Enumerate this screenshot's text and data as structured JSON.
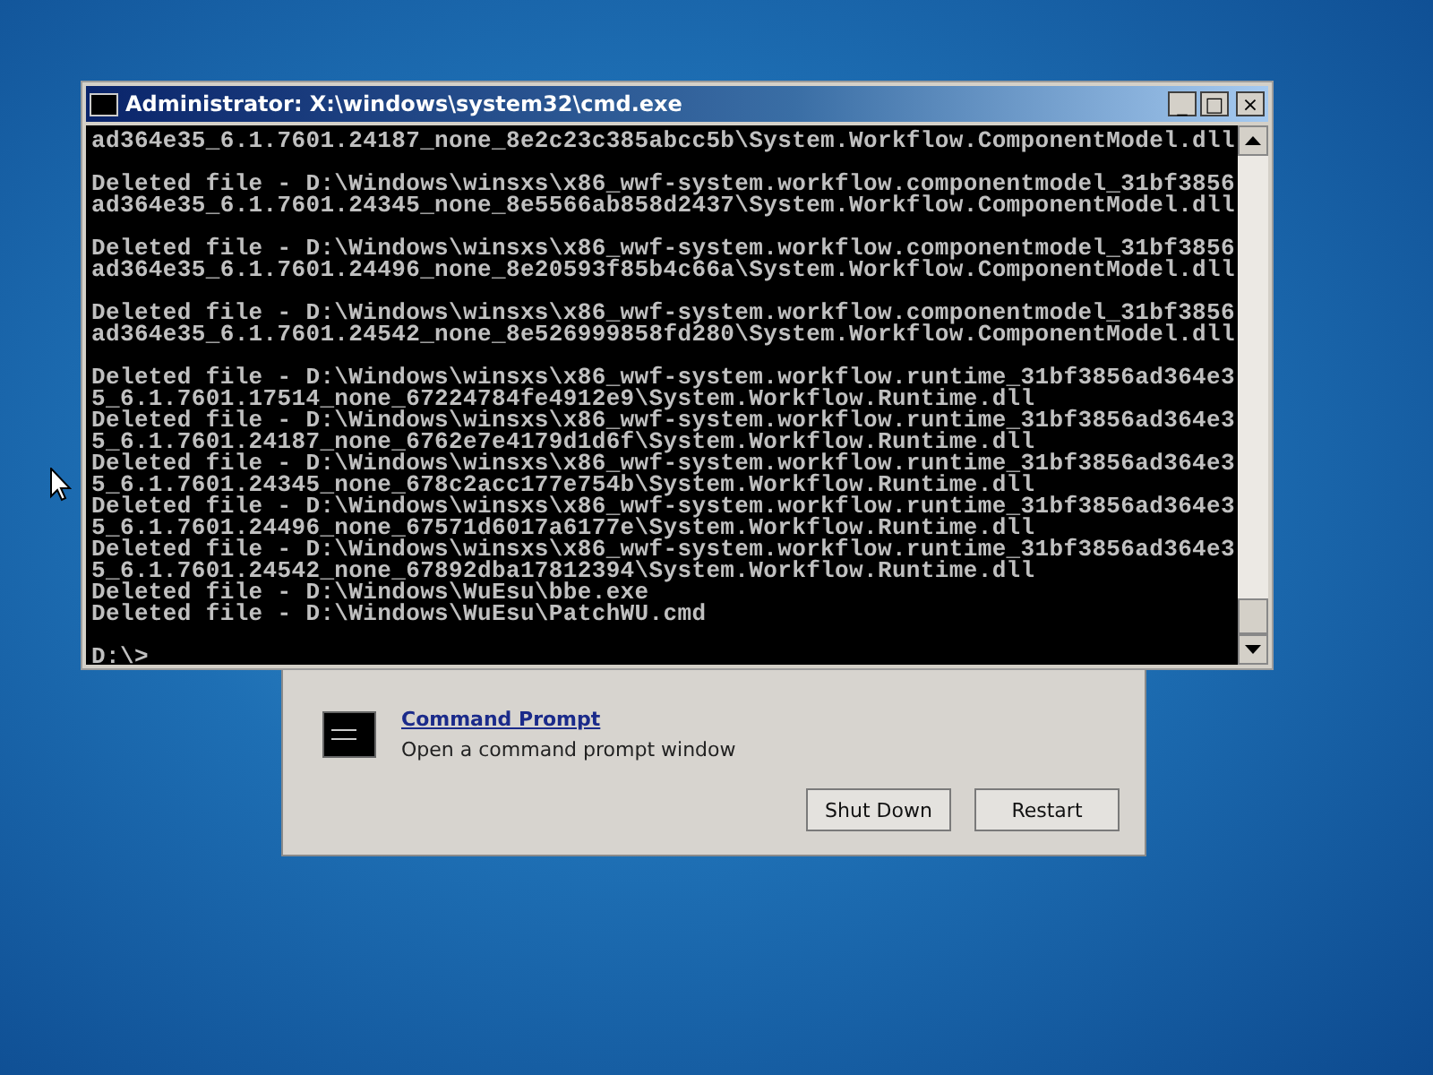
{
  "dialog": {
    "tool": {
      "title": "Command Prompt",
      "description": "Open a command prompt window"
    },
    "buttons": [
      "Shut Down",
      "Restart"
    ]
  },
  "window": {
    "title": "Administrator: X:\\windows\\system32\\cmd.exe",
    "minimize": "_",
    "maximize": "□",
    "close": "×"
  },
  "console": {
    "blocks": [
      [
        "ad364e35_6.1.7601.24187_none_8e2c23c385abcc5b\\System.Workflow.ComponentModel.dll"
      ],
      [
        "Deleted file - D:\\Windows\\winsxs\\x86_wwf-system.workflow.componentmodel_31bf3856",
        "ad364e35_6.1.7601.24345_none_8e5566ab858d2437\\System.Workflow.ComponentModel.dll"
      ],
      [
        "Deleted file - D:\\Windows\\winsxs\\x86_wwf-system.workflow.componentmodel_31bf3856",
        "ad364e35_6.1.7601.24496_none_8e20593f85b4c66a\\System.Workflow.ComponentModel.dll"
      ],
      [
        "Deleted file - D:\\Windows\\winsxs\\x86_wwf-system.workflow.componentmodel_31bf3856",
        "ad364e35_6.1.7601.24542_none_8e526999858fd280\\System.Workflow.ComponentModel.dll"
      ],
      [
        "Deleted file - D:\\Windows\\winsxs\\x86_wwf-system.workflow.runtime_31bf3856ad364e3",
        "5_6.1.7601.17514_none_67224784fe4912e9\\System.Workflow.Runtime.dll",
        "Deleted file - D:\\Windows\\winsxs\\x86_wwf-system.workflow.runtime_31bf3856ad364e3",
        "5_6.1.7601.24187_none_6762e7e4179d1d6f\\System.Workflow.Runtime.dll",
        "Deleted file - D:\\Windows\\winsxs\\x86_wwf-system.workflow.runtime_31bf3856ad364e3",
        "5_6.1.7601.24345_none_678c2acc177e754b\\System.Workflow.Runtime.dll",
        "Deleted file - D:\\Windows\\winsxs\\x86_wwf-system.workflow.runtime_31bf3856ad364e3",
        "5_6.1.7601.24496_none_67571d6017a6177e\\System.Workflow.Runtime.dll",
        "Deleted file - D:\\Windows\\winsxs\\x86_wwf-system.workflow.runtime_31bf3856ad364e3",
        "5_6.1.7601.24542_none_67892dba17812394\\System.Workflow.Runtime.dll",
        "Deleted file - D:\\Windows\\WuEsu\\bbe.exe",
        "Deleted file - D:\\Windows\\WuEsu\\PatchWU.cmd"
      ],
      [
        "D:\\>"
      ]
    ]
  }
}
